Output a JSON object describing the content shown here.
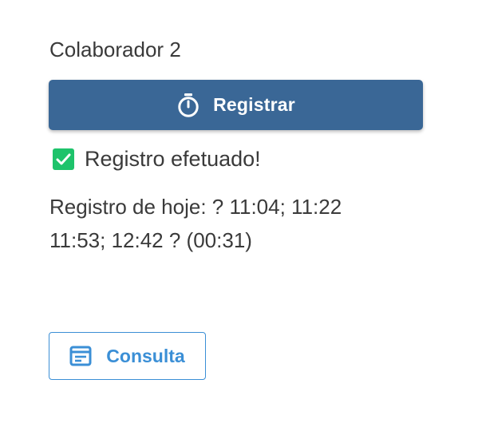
{
  "user": {
    "name": "Colaborador 2"
  },
  "register_button": {
    "label": "Registrar",
    "icon": "stopwatch-icon"
  },
  "status": {
    "text": "Registro efetuado!",
    "icon": "checkbox-checked-icon",
    "color": "#1ec36b"
  },
  "record": {
    "line1": "Registro de hoje: ? 11:04; 11:22",
    "line2": "11:53; 12:42 ? (00:31)"
  },
  "consulta_button": {
    "label": "Consulta",
    "icon": "document-list-icon"
  },
  "colors": {
    "primary": "#3a6796",
    "accent": "#3b8fd6",
    "text": "#3a3a3a"
  }
}
